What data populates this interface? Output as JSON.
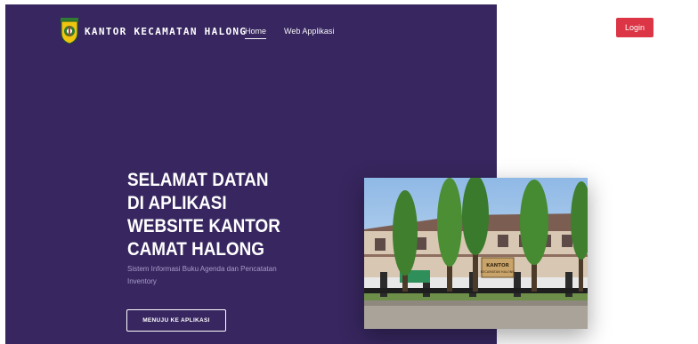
{
  "brand": {
    "name": "KANTOR KECAMATAN HALONG"
  },
  "nav": {
    "home": "Home",
    "web": "Web Applikasi"
  },
  "auth": {
    "login_label": "Login"
  },
  "hero": {
    "title": "SELAMAT DATAN DI APLIKASI WEBSITE KANTOR CAMAT HALONG",
    "subtitle": "Sistem Informasi Buku Agenda dan Pencatatan Inventory",
    "cta_label": "MENUJU KE APLIKASI",
    "background_color": "#37265f"
  },
  "photo": {
    "sign_line1": "KANTOR",
    "sign_line2": "KECAMATAN HALONG"
  },
  "colors": {
    "login": "#dc3545",
    "page": "#ffffff"
  },
  "icons": {
    "logo": "government-emblem-icon"
  }
}
